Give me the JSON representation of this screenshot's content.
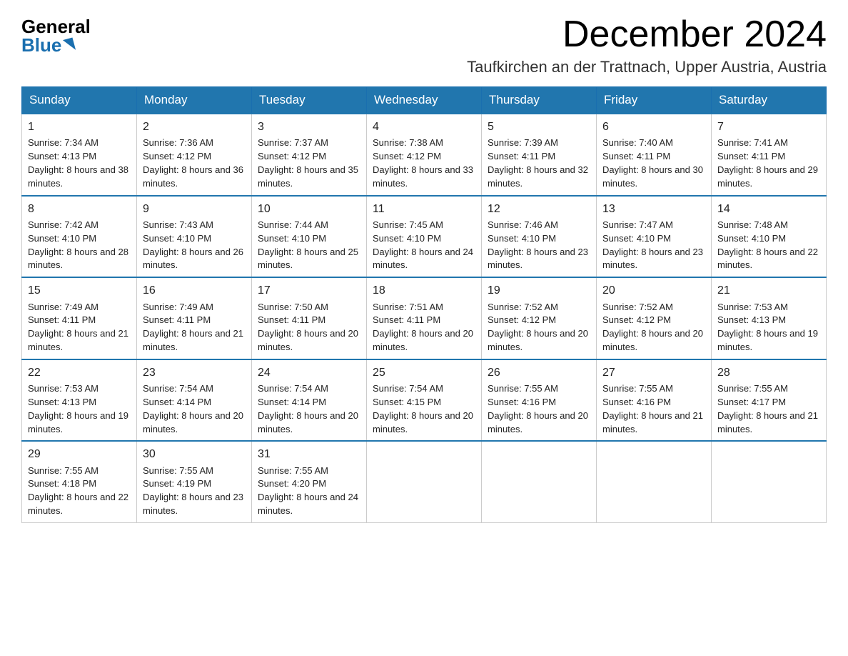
{
  "logo": {
    "general": "General",
    "blue": "Blue"
  },
  "header": {
    "month_year": "December 2024",
    "location": "Taufkirchen an der Trattnach, Upper Austria, Austria"
  },
  "days_of_week": [
    "Sunday",
    "Monday",
    "Tuesday",
    "Wednesday",
    "Thursday",
    "Friday",
    "Saturday"
  ],
  "weeks": [
    [
      {
        "day": "1",
        "sunrise": "7:34 AM",
        "sunset": "4:13 PM",
        "daylight": "8 hours and 38 minutes."
      },
      {
        "day": "2",
        "sunrise": "7:36 AM",
        "sunset": "4:12 PM",
        "daylight": "8 hours and 36 minutes."
      },
      {
        "day": "3",
        "sunrise": "7:37 AM",
        "sunset": "4:12 PM",
        "daylight": "8 hours and 35 minutes."
      },
      {
        "day": "4",
        "sunrise": "7:38 AM",
        "sunset": "4:12 PM",
        "daylight": "8 hours and 33 minutes."
      },
      {
        "day": "5",
        "sunrise": "7:39 AM",
        "sunset": "4:11 PM",
        "daylight": "8 hours and 32 minutes."
      },
      {
        "day": "6",
        "sunrise": "7:40 AM",
        "sunset": "4:11 PM",
        "daylight": "8 hours and 30 minutes."
      },
      {
        "day": "7",
        "sunrise": "7:41 AM",
        "sunset": "4:11 PM",
        "daylight": "8 hours and 29 minutes."
      }
    ],
    [
      {
        "day": "8",
        "sunrise": "7:42 AM",
        "sunset": "4:10 PM",
        "daylight": "8 hours and 28 minutes."
      },
      {
        "day": "9",
        "sunrise": "7:43 AM",
        "sunset": "4:10 PM",
        "daylight": "8 hours and 26 minutes."
      },
      {
        "day": "10",
        "sunrise": "7:44 AM",
        "sunset": "4:10 PM",
        "daylight": "8 hours and 25 minutes."
      },
      {
        "day": "11",
        "sunrise": "7:45 AM",
        "sunset": "4:10 PM",
        "daylight": "8 hours and 24 minutes."
      },
      {
        "day": "12",
        "sunrise": "7:46 AM",
        "sunset": "4:10 PM",
        "daylight": "8 hours and 23 minutes."
      },
      {
        "day": "13",
        "sunrise": "7:47 AM",
        "sunset": "4:10 PM",
        "daylight": "8 hours and 23 minutes."
      },
      {
        "day": "14",
        "sunrise": "7:48 AM",
        "sunset": "4:10 PM",
        "daylight": "8 hours and 22 minutes."
      }
    ],
    [
      {
        "day": "15",
        "sunrise": "7:49 AM",
        "sunset": "4:11 PM",
        "daylight": "8 hours and 21 minutes."
      },
      {
        "day": "16",
        "sunrise": "7:49 AM",
        "sunset": "4:11 PM",
        "daylight": "8 hours and 21 minutes."
      },
      {
        "day": "17",
        "sunrise": "7:50 AM",
        "sunset": "4:11 PM",
        "daylight": "8 hours and 20 minutes."
      },
      {
        "day": "18",
        "sunrise": "7:51 AM",
        "sunset": "4:11 PM",
        "daylight": "8 hours and 20 minutes."
      },
      {
        "day": "19",
        "sunrise": "7:52 AM",
        "sunset": "4:12 PM",
        "daylight": "8 hours and 20 minutes."
      },
      {
        "day": "20",
        "sunrise": "7:52 AM",
        "sunset": "4:12 PM",
        "daylight": "8 hours and 20 minutes."
      },
      {
        "day": "21",
        "sunrise": "7:53 AM",
        "sunset": "4:13 PM",
        "daylight": "8 hours and 19 minutes."
      }
    ],
    [
      {
        "day": "22",
        "sunrise": "7:53 AM",
        "sunset": "4:13 PM",
        "daylight": "8 hours and 19 minutes."
      },
      {
        "day": "23",
        "sunrise": "7:54 AM",
        "sunset": "4:14 PM",
        "daylight": "8 hours and 20 minutes."
      },
      {
        "day": "24",
        "sunrise": "7:54 AM",
        "sunset": "4:14 PM",
        "daylight": "8 hours and 20 minutes."
      },
      {
        "day": "25",
        "sunrise": "7:54 AM",
        "sunset": "4:15 PM",
        "daylight": "8 hours and 20 minutes."
      },
      {
        "day": "26",
        "sunrise": "7:55 AM",
        "sunset": "4:16 PM",
        "daylight": "8 hours and 20 minutes."
      },
      {
        "day": "27",
        "sunrise": "7:55 AM",
        "sunset": "4:16 PM",
        "daylight": "8 hours and 21 minutes."
      },
      {
        "day": "28",
        "sunrise": "7:55 AM",
        "sunset": "4:17 PM",
        "daylight": "8 hours and 21 minutes."
      }
    ],
    [
      {
        "day": "29",
        "sunrise": "7:55 AM",
        "sunset": "4:18 PM",
        "daylight": "8 hours and 22 minutes."
      },
      {
        "day": "30",
        "sunrise": "7:55 AM",
        "sunset": "4:19 PM",
        "daylight": "8 hours and 23 minutes."
      },
      {
        "day": "31",
        "sunrise": "7:55 AM",
        "sunset": "4:20 PM",
        "daylight": "8 hours and 24 minutes."
      },
      null,
      null,
      null,
      null
    ]
  ],
  "labels": {
    "sunrise": "Sunrise:",
    "sunset": "Sunset:",
    "daylight": "Daylight:"
  }
}
